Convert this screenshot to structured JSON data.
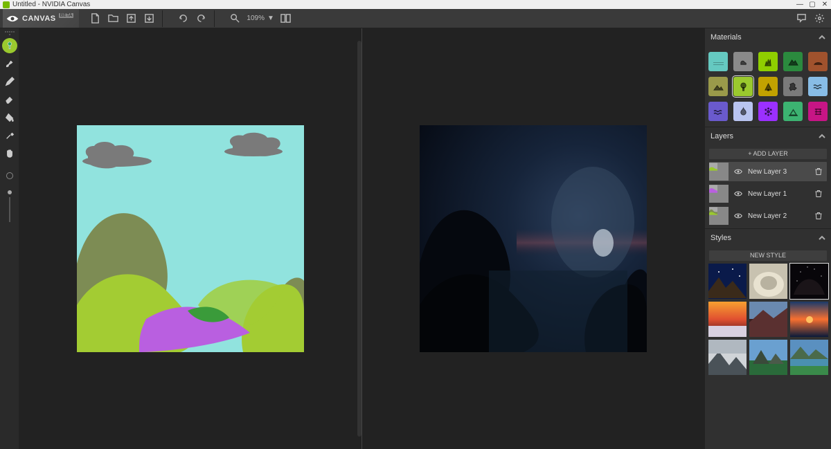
{
  "window": {
    "title": "Untitled - NVIDIA Canvas"
  },
  "brand": {
    "name": "CANVAS",
    "tag": "BETA"
  },
  "toolbar": {
    "zoom_label": "109%"
  },
  "materials": {
    "title": "Materials",
    "items": [
      {
        "name": "sky",
        "color": "#65c9c1"
      },
      {
        "name": "cloud",
        "color": "#8a8a8a"
      },
      {
        "name": "grass",
        "color": "#8fce00"
      },
      {
        "name": "mountain",
        "color": "#2b8a3e"
      },
      {
        "name": "dirt",
        "color": "#a0522d"
      },
      {
        "name": "hill",
        "color": "#9a9a4a"
      },
      {
        "name": "tree",
        "color": "#9ac92e",
        "selected": true
      },
      {
        "name": "bush",
        "color": "#c2a200"
      },
      {
        "name": "rock",
        "color": "#7a7a7a"
      },
      {
        "name": "water",
        "color": "#88bde6"
      },
      {
        "name": "sea",
        "color": "#6a5acd"
      },
      {
        "name": "fog",
        "color": "#b9c4f0"
      },
      {
        "name": "flower",
        "color": "#9b30ff"
      },
      {
        "name": "river",
        "color": "#3cb371"
      },
      {
        "name": "sand",
        "color": "#c71585"
      }
    ]
  },
  "layers": {
    "title": "Layers",
    "add_label": "+ ADD LAYER",
    "items": [
      {
        "name": "New Layer 3",
        "active": true
      },
      {
        "name": "New Layer 1",
        "active": false
      },
      {
        "name": "New Layer 2",
        "active": false
      }
    ]
  },
  "styles": {
    "title": "Styles",
    "new_label": "NEW STYLE",
    "selected_index": 2
  }
}
